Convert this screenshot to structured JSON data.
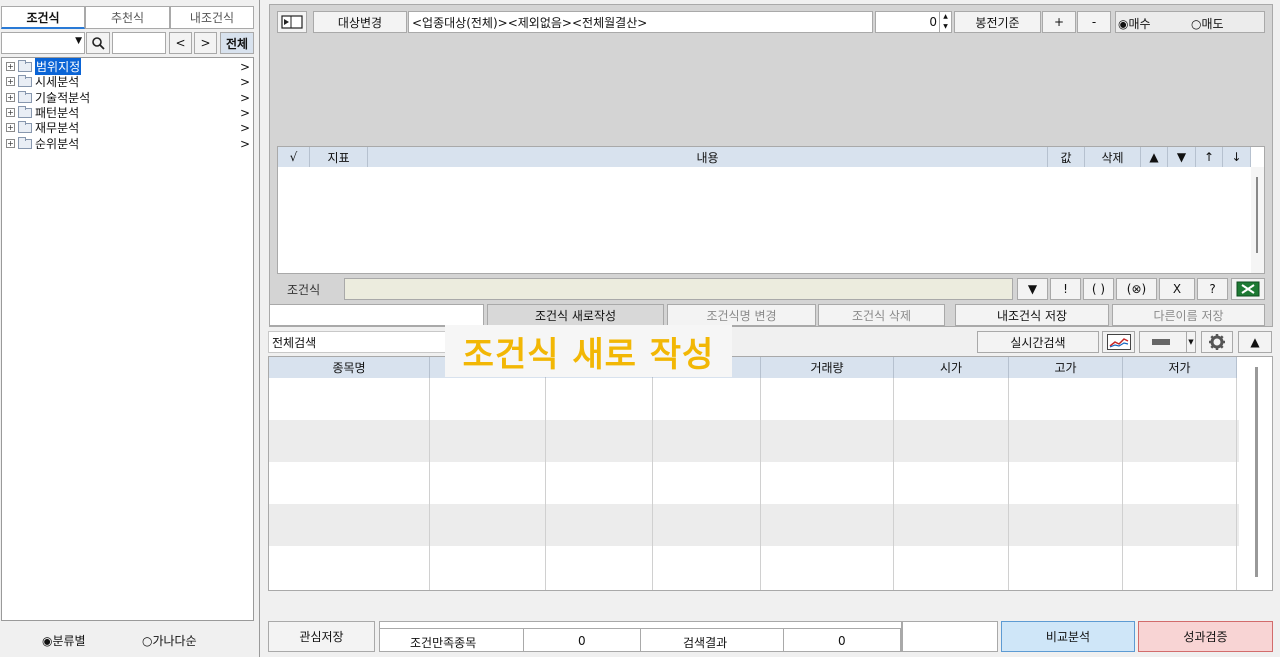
{
  "left_panel": {
    "tabs": [
      {
        "label": "조건식",
        "active": true
      },
      {
        "label": "추천식",
        "active": false
      },
      {
        "label": "내조건식",
        "active": false
      }
    ],
    "search": {
      "dropdown_value": "",
      "text_value": "",
      "all_button": "전체"
    },
    "tree": [
      {
        "label": "범위지정",
        "selected": true
      },
      {
        "label": "시세분석",
        "selected": false
      },
      {
        "label": "기술적분석",
        "selected": false
      },
      {
        "label": "패턴분석",
        "selected": false
      },
      {
        "label": "재무분석",
        "selected": false
      },
      {
        "label": "순위분석",
        "selected": false
      }
    ],
    "tree_chevron": ">",
    "sort": {
      "option1": "◉분류별",
      "option2": "○가나다순"
    }
  },
  "top_bar": {
    "target_change": "대상변경",
    "target_text": "<업종대상(전체)><제외없음><전체월결산>",
    "number_value": "0",
    "candle_basis": "봉전기준",
    "plus": "+",
    "minus": "-",
    "buy": "◉매수",
    "sell": "○매도"
  },
  "condition_table": {
    "headers": [
      "√",
      "지표",
      "내용",
      "값",
      "삭제",
      "▲",
      "▼",
      "↑",
      "↓"
    ]
  },
  "formula": {
    "label": "조건식",
    "value": "",
    "ops": [
      "▼",
      "!",
      "( )",
      "(⊗)",
      "X",
      "?"
    ]
  },
  "action_buttons": {
    "name_input": "",
    "new": "조건식 새로작성",
    "rename": "조건식명 변경",
    "delete": "조건식 삭제",
    "save": "내조건식 저장",
    "save_as": "다른이름 저장"
  },
  "tooltip": "조건식 새로 작성",
  "results": {
    "search_field": "전체검색",
    "realtime": "실시간검색",
    "up_arrow": "▲",
    "headers": [
      "종목명",
      "",
      "",
      "",
      "거래량",
      "시가",
      "고가",
      "저가"
    ]
  },
  "footer": {
    "save_interest": "관심저장",
    "satisfied_label": "조건만족종목",
    "satisfied_count": "0",
    "result_label": "검색결과",
    "result_count": "0",
    "compare": "비교분석",
    "performance": "성과검증"
  },
  "colors": {
    "tooltip_text": "#f2b705",
    "header_bg": "#d8e2ee",
    "compare_bg": "#cfe6f8",
    "performance_bg": "#f8d4d4"
  }
}
